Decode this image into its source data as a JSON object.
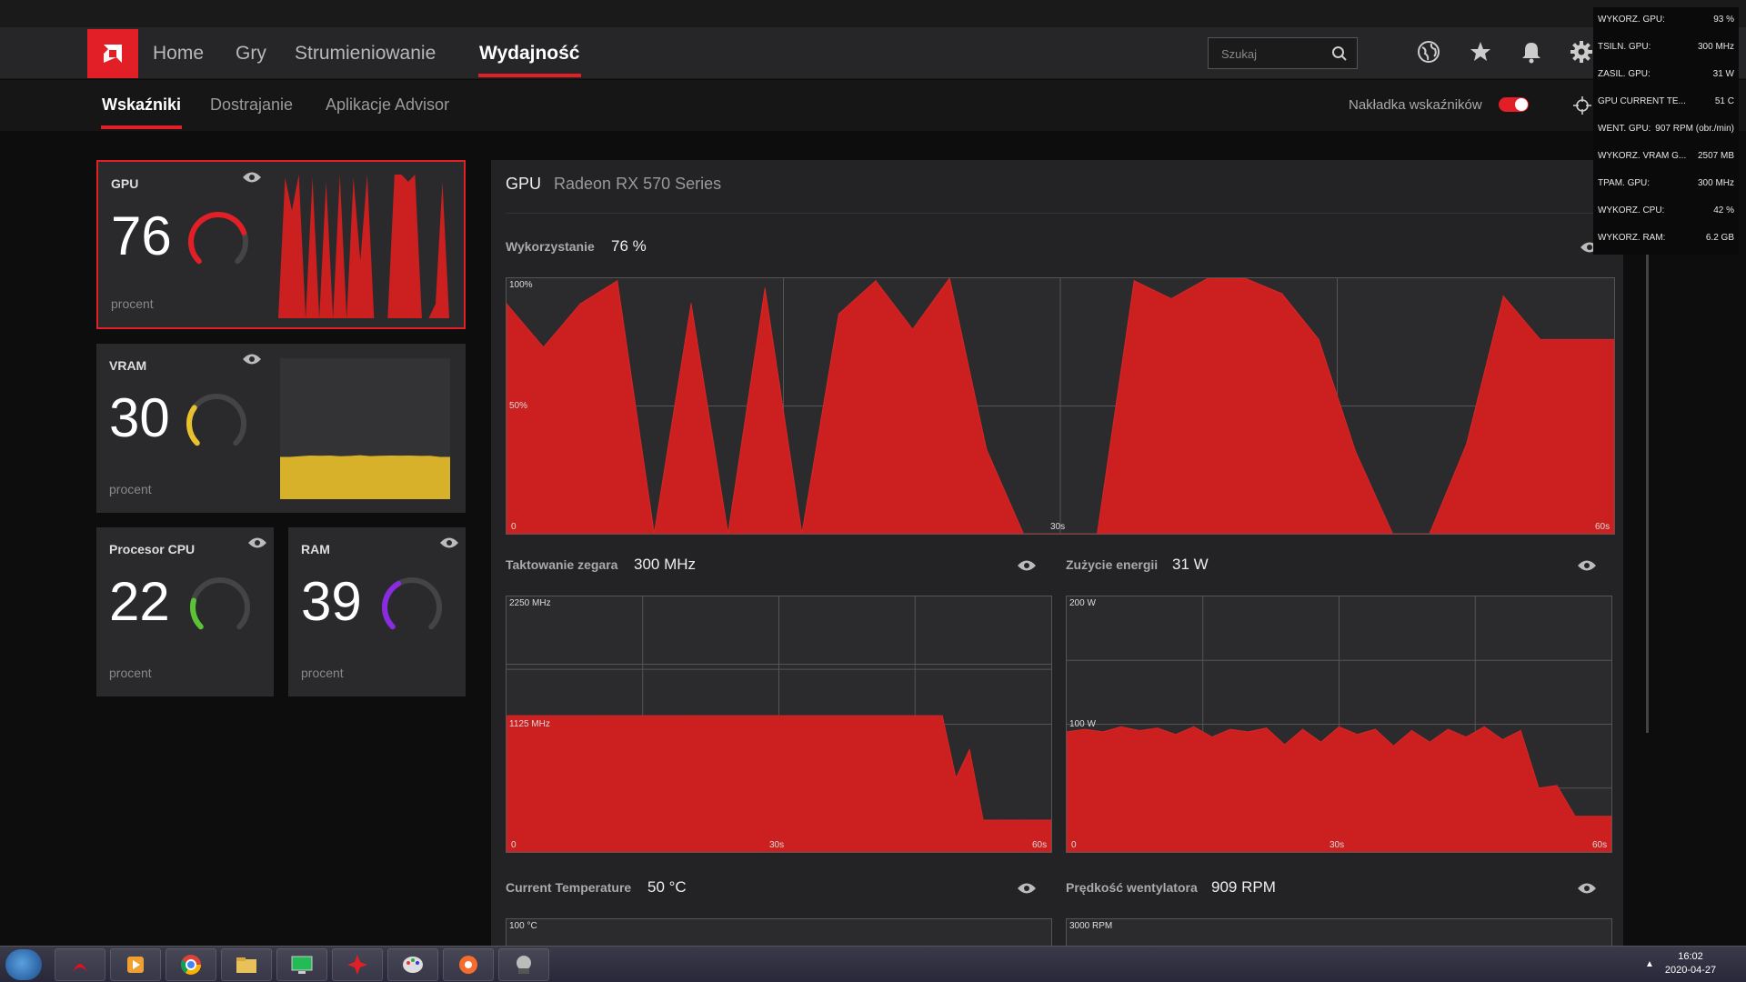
{
  "nav": {
    "items": [
      "Home",
      "Gry",
      "Strumieniowanie",
      "Wydajność"
    ],
    "active": "Wydajność",
    "search_placeholder": "Szukaj"
  },
  "subnav": {
    "items": [
      "Wskaźniki",
      "Dostrajanie",
      "Aplikacje Advisor"
    ],
    "overlay_label": "Nakładka wskaźników",
    "overlay_on": true
  },
  "cards": {
    "gpu": {
      "title": "GPU",
      "value": "76",
      "unit": "procent",
      "color": "#e21e26"
    },
    "vram": {
      "title": "VRAM",
      "value": "30",
      "unit": "procent",
      "color": "#e8c12e"
    },
    "cpu": {
      "title": "Procesor CPU",
      "value": "22",
      "unit": "procent",
      "color": "#5bc236"
    },
    "ram": {
      "title": "RAM",
      "value": "39",
      "unit": "procent",
      "color": "#8a2be2"
    }
  },
  "detail": {
    "header": {
      "title": "GPU",
      "model": "Radeon RX 570 Series"
    },
    "usage": {
      "label": "Wykorzystanie",
      "value": "76 %"
    },
    "clock": {
      "label": "Taktowanie zegara",
      "value": "300 MHz"
    },
    "power": {
      "label": "Zużycie energii",
      "value": "31 W"
    },
    "temp": {
      "label": "Current Temperature",
      "value": "50 °C"
    },
    "fan": {
      "label": "Prędkość wentylatora",
      "value": "909 RPM"
    }
  },
  "chart_data": [
    {
      "type": "area",
      "name": "Wykorzystanie",
      "ylim": [
        0,
        100
      ],
      "ytick_labels": [
        "100%",
        "50%",
        "0"
      ],
      "xtick_labels": [
        "30s",
        "60s"
      ],
      "x": [
        0,
        2,
        4,
        6,
        8,
        10,
        12,
        14,
        16,
        18,
        20,
        22,
        24,
        26,
        28,
        30,
        32,
        34,
        36,
        38,
        40,
        42,
        44,
        46,
        48,
        50,
        52,
        54,
        56,
        58,
        60
      ],
      "values": [
        90,
        73,
        90,
        99,
        0,
        90,
        0,
        96,
        0,
        86,
        99,
        80,
        100,
        33,
        0,
        0,
        0,
        99,
        92,
        100,
        100,
        94,
        76,
        32,
        0,
        0,
        35,
        93,
        76,
        76,
        76
      ],
      "color": "#cc1f1f"
    },
    {
      "type": "area",
      "name": "Taktowanie zegara",
      "ylim": [
        0,
        2250
      ],
      "ytick_labels": [
        "2250 MHz",
        "1125 MHz",
        "0"
      ],
      "xtick_labels": [
        "30s",
        "60s"
      ],
      "x": [
        0,
        10,
        20,
        30,
        40,
        48,
        49.5,
        51,
        52.5,
        54,
        57,
        60
      ],
      "values": [
        1200,
        1200,
        1200,
        1200,
        1200,
        1200,
        650,
        900,
        280,
        280,
        280,
        280
      ],
      "color": "#cc1f1f"
    },
    {
      "type": "area",
      "name": "Zużycie energii",
      "ylim": [
        0,
        200
      ],
      "ytick_labels": [
        "200 W",
        "100 W",
        "0"
      ],
      "xtick_labels": [
        "30s",
        "60s"
      ],
      "x": [
        0,
        2,
        4,
        6,
        8,
        10,
        12,
        14,
        16,
        18,
        20,
        22,
        24,
        26,
        28,
        30,
        32,
        34,
        36,
        38,
        40,
        42,
        44,
        46,
        48,
        50,
        52,
        54,
        56,
        58,
        60
      ],
      "values": [
        94,
        96,
        94,
        98,
        95,
        97,
        92,
        98,
        90,
        96,
        94,
        97,
        84,
        96,
        86,
        98,
        92,
        96,
        83,
        95,
        86,
        96,
        90,
        98,
        88,
        95,
        50,
        52,
        28,
        28,
        28
      ],
      "color": "#cc1f1f"
    }
  ],
  "sparklines": {
    "gpu": [
      0,
      98,
      75,
      100,
      0,
      98,
      0,
      95,
      0,
      100,
      0,
      98,
      40,
      100,
      0,
      0,
      0,
      100,
      100,
      95,
      100,
      0,
      0,
      10,
      95,
      0
    ],
    "vram": [
      30,
      30,
      30.5,
      31,
      30.8,
      31,
      30.5,
      30.7,
      31.2,
      30.6,
      30.8,
      31,
      30.9,
      31,
      30.7,
      30.8,
      30,
      30
    ]
  },
  "osd": [
    {
      "k": "WYKORZ. GPU:",
      "v": "93 %"
    },
    {
      "k": "TSILN. GPU:",
      "v": "300 MHz"
    },
    {
      "k": "ZASIL. GPU:",
      "v": "31 W"
    },
    {
      "k": "GPU CURRENT TE...",
      "v": "51 C"
    },
    {
      "k": "WENT. GPU:",
      "v": "907 RPM (obr./min)"
    },
    {
      "k": "WYKORZ. VRAM G...",
      "v": "2507 MB"
    },
    {
      "k": "TPAM. GPU:",
      "v": "300 MHz"
    },
    {
      "k": "WYKORZ. CPU:",
      "v": "42 %"
    },
    {
      "k": "WYKORZ. RAM:",
      "v": "6.2 GB"
    }
  ],
  "taskbar": {
    "time": "16:02",
    "date": "2020-04-27",
    "apps": [
      "acrobat-icon",
      "media-player-icon",
      "chrome-icon",
      "file-explorer-icon",
      "monitor-app-icon",
      "amd-radeon-icon",
      "paint-icon",
      "origin-icon",
      "game-icon"
    ]
  },
  "colors": {
    "accent": "#e21e26",
    "chart_fill": "#cc1f1f"
  }
}
